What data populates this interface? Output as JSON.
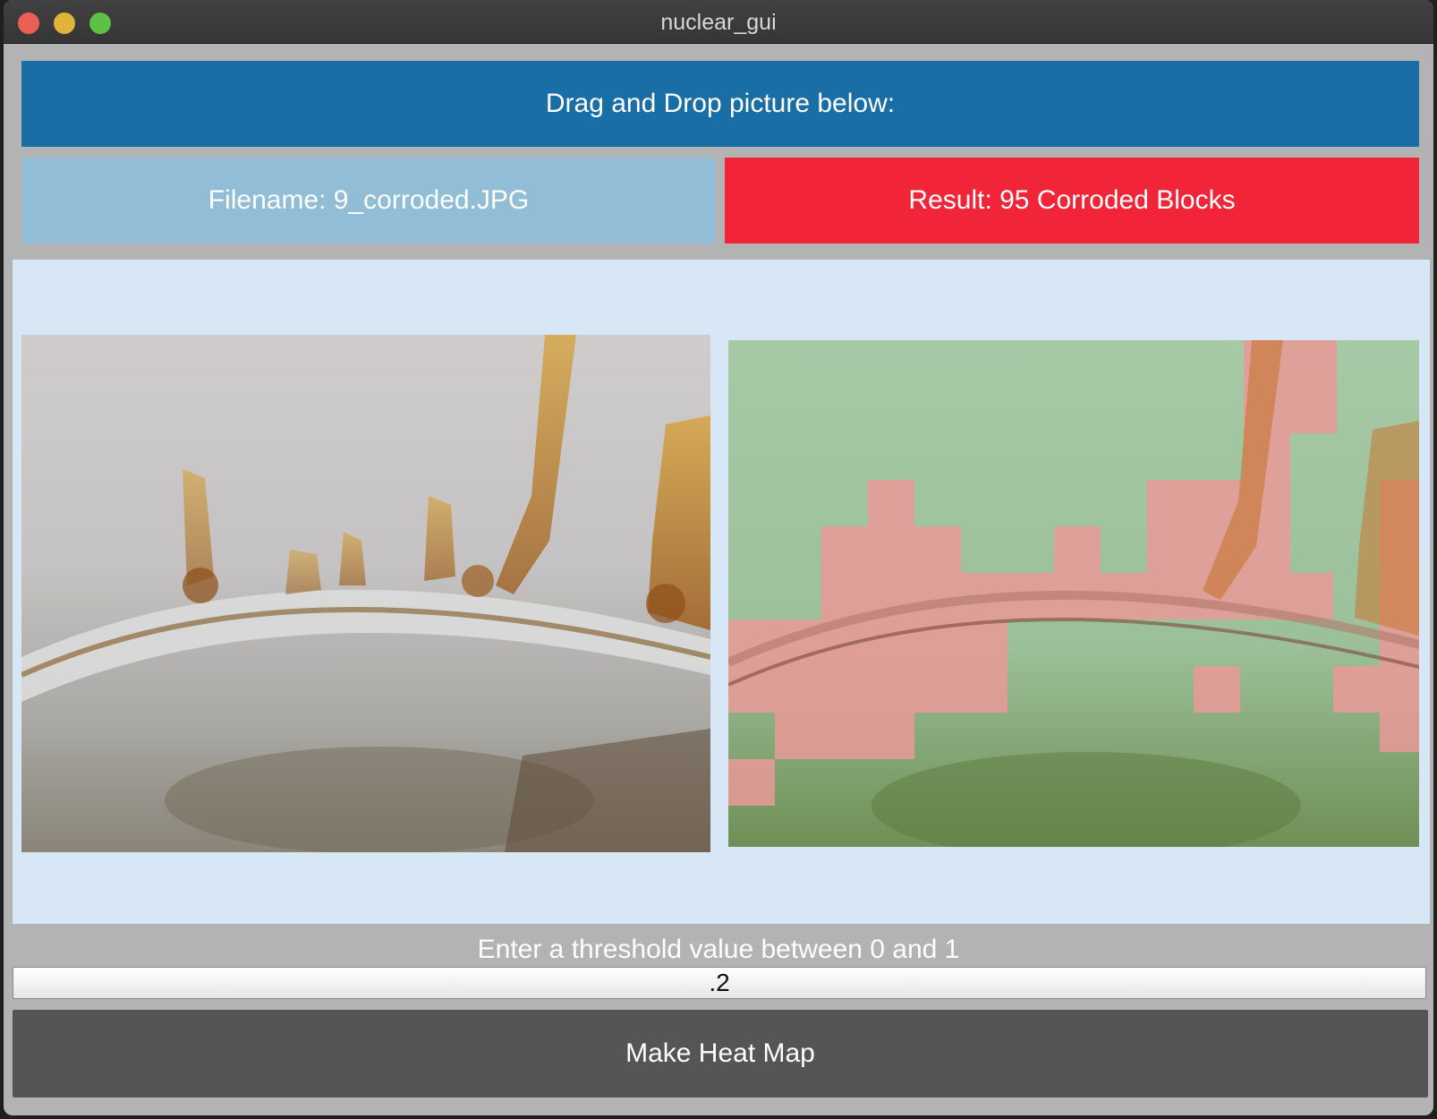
{
  "window": {
    "title": "nuclear_gui"
  },
  "header": {
    "drop_label": "Drag and Drop picture below:"
  },
  "info": {
    "filename_label": "Filename: 9_corroded.JPG",
    "result_label": "Result: 95 Corroded Blocks"
  },
  "images": {
    "original": "corroded-weld-photo",
    "heatmap": "corrosion-heat-map-overlay"
  },
  "threshold": {
    "prompt": "Enter a threshold value between 0 and 1",
    "value": ".2"
  },
  "actions": {
    "make_heat_map": "Make Heat Map"
  },
  "colors": {
    "drop_bar": "#1a6ea6",
    "filename_bar": "#91bdd6",
    "result_bar": "#f22437",
    "canvas": "#d8e7f5",
    "button": "#555555",
    "heat_ok": "#7fbf8c",
    "heat_corroded": "#e88a8a"
  }
}
